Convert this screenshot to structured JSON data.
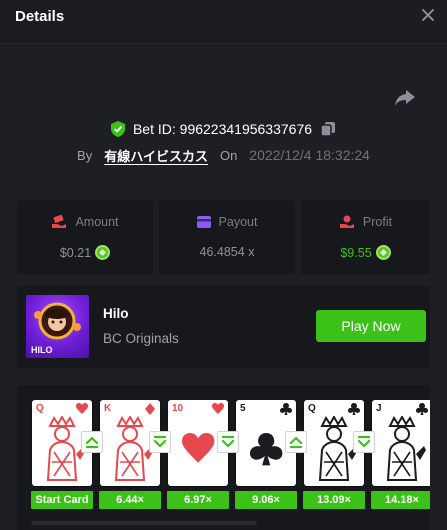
{
  "header": {
    "title": "Details"
  },
  "bet": {
    "id_label": "Bet ID:",
    "id_value": "99622341956337676",
    "by_label": "By",
    "user": "有線ハイビスカス",
    "on_label": "On",
    "date": "2022/12/4 18:32:24"
  },
  "stats": {
    "amount": {
      "label": "Amount",
      "value": "$0.21"
    },
    "payout": {
      "label": "Payout",
      "value": "46.4854 x"
    },
    "profit": {
      "label": "Profit",
      "value": "$9.55"
    }
  },
  "game": {
    "name": "Hilo",
    "provider": "BC Originals",
    "thumb_label": "HILO",
    "play_label": "Play Now"
  },
  "cards": [
    {
      "rank": "Q",
      "suit": "heart",
      "multiplier": "Start Card"
    },
    {
      "rank": "K",
      "suit": "diamond",
      "multiplier": "6.44×",
      "arrow": "up"
    },
    {
      "rank": "10",
      "suit": "heart",
      "multiplier": "6.97×",
      "arrow": "down"
    },
    {
      "rank": "5",
      "suit": "club",
      "multiplier": "9.06×",
      "arrow": "down"
    },
    {
      "rank": "Q",
      "suit": "club",
      "multiplier": "13.09×",
      "arrow": "up"
    },
    {
      "rank": "J",
      "suit": "club",
      "multiplier": "14.18×",
      "arrow": "down"
    }
  ],
  "colors": {
    "accent_green": "#3bc117",
    "red_suit": "#e5484d",
    "black_suit": "#1b1c20",
    "background": "#1e1f23",
    "panel": "#17181b"
  }
}
